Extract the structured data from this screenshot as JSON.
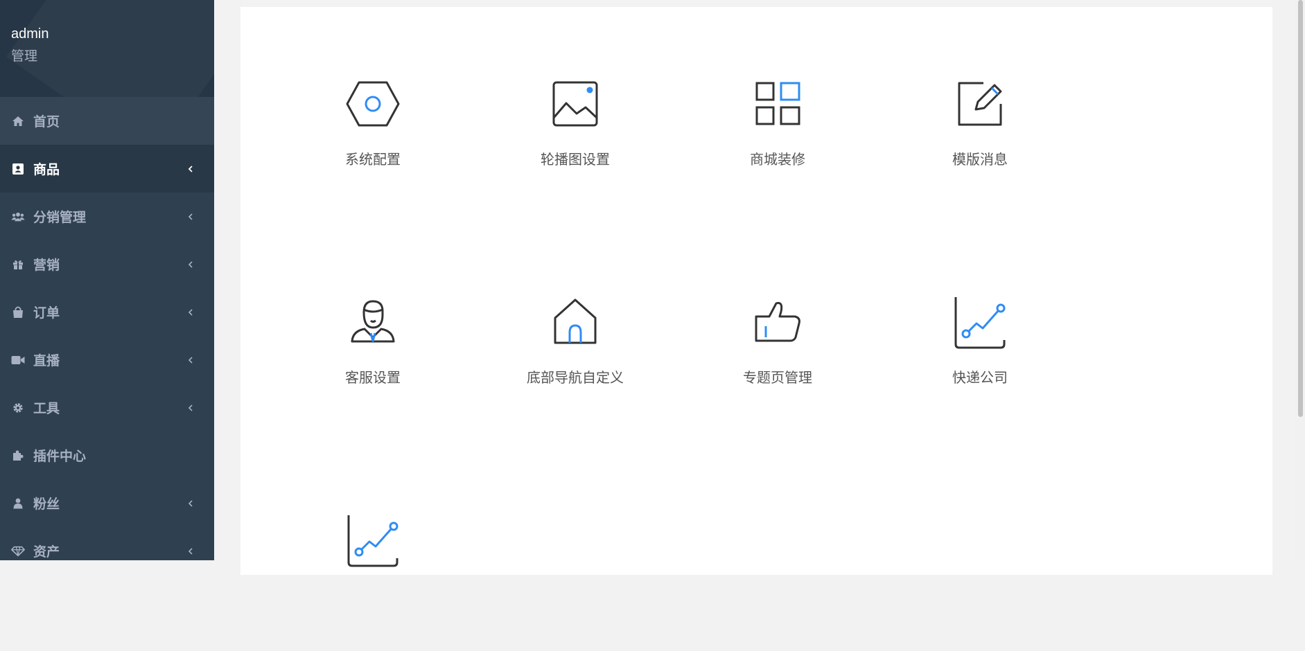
{
  "user": {
    "name": "admin",
    "role": "管理"
  },
  "sidebar": {
    "items": [
      {
        "label": "首页",
        "icon": "home-icon",
        "has_chevron": false
      },
      {
        "label": "商品",
        "icon": "contact-card-icon",
        "has_chevron": true
      },
      {
        "label": "分销管理",
        "icon": "users-icon",
        "has_chevron": true
      },
      {
        "label": "营销",
        "icon": "gift-icon",
        "has_chevron": true
      },
      {
        "label": "订单",
        "icon": "shopping-bag-icon",
        "has_chevron": true
      },
      {
        "label": "直播",
        "icon": "video-camera-icon",
        "has_chevron": true
      },
      {
        "label": "工具",
        "icon": "gear-icon",
        "has_chevron": true
      },
      {
        "label": "插件中心",
        "icon": "puzzle-icon",
        "has_chevron": false
      },
      {
        "label": "粉丝",
        "icon": "user-icon",
        "has_chevron": true
      },
      {
        "label": "资产",
        "icon": "diamond-icon",
        "has_chevron": true
      }
    ],
    "active_item": "商品"
  },
  "tiles": [
    {
      "label": "系统配置",
      "icon": "hexagon-icon"
    },
    {
      "label": "轮播图设置",
      "icon": "image-icon"
    },
    {
      "label": "商城装修",
      "icon": "grid-icon"
    },
    {
      "label": "模版消息",
      "icon": "edit-icon"
    },
    {
      "label": "客服设置",
      "icon": "customer-service-icon"
    },
    {
      "label": "底部导航自定义",
      "icon": "house-icon"
    },
    {
      "label": "专题页管理",
      "icon": "thumbs-up-icon"
    },
    {
      "label": "快递公司",
      "icon": "line-chart-icon"
    },
    {
      "label": "",
      "icon": "line-chart-icon"
    }
  ],
  "colors": {
    "sidebar_bg": "#2f4050",
    "sidebar_active_bg": "#293846",
    "sidebar_text": "#a7b1c2",
    "accent_blue": "#2f8cf4",
    "icon_dark": "#333333"
  }
}
